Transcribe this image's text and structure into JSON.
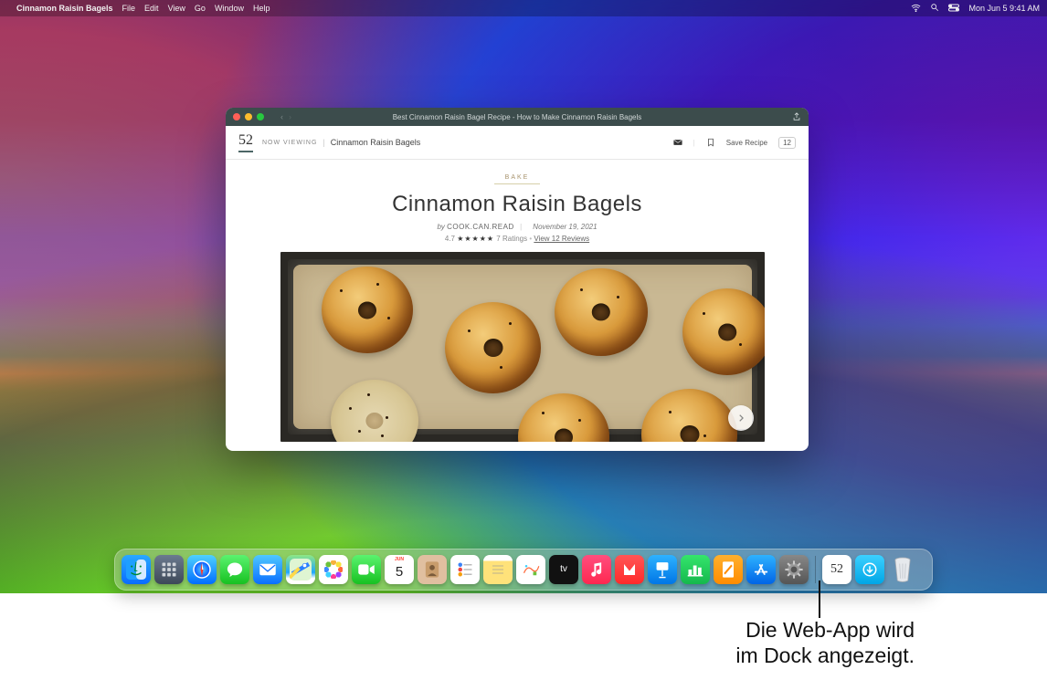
{
  "menubar": {
    "app_name": "Cinnamon Raisin Bagels",
    "items": [
      "File",
      "Edit",
      "View",
      "Go",
      "Window",
      "Help"
    ],
    "clock": "Mon Jun 5  9:41 AM"
  },
  "window": {
    "title": "Best Cinnamon Raisin Bagel Recipe - How to Make Cinnamon Raisin Bagels"
  },
  "site": {
    "logo": "52",
    "now_viewing_label": "NOW VIEWING",
    "now_viewing_value": "Cinnamon Raisin Bagels",
    "save_label": "Save Recipe",
    "comment_count": "12"
  },
  "recipe": {
    "category": "BAKE",
    "title": "Cinnamon Raisin Bagels",
    "by_label": "by",
    "author": "COOK.CAN.READ",
    "date": "November 19, 2021",
    "rating_value": "4.7",
    "stars": "★★★★★",
    "ratings_text": "7 Ratings",
    "reviews_link": "View 12 Reviews"
  },
  "calendar": {
    "month": "JUN",
    "day": "5"
  },
  "dock_apps": [
    "Finder",
    "Launchpad",
    "Safari",
    "Messages",
    "Mail",
    "Maps",
    "Photos",
    "FaceTime",
    "Calendar",
    "Contacts",
    "Reminders",
    "Notes",
    "Freeform",
    "TV",
    "Music",
    "News",
    "Keynote",
    "Numbers",
    "Pages",
    "App Store",
    "System Settings"
  ],
  "dock_right": [
    "Food52 Web App",
    "Downloads",
    "Trash"
  ],
  "callout": {
    "line1": "Die Web-App wird",
    "line2": "im Dock angezeigt."
  }
}
